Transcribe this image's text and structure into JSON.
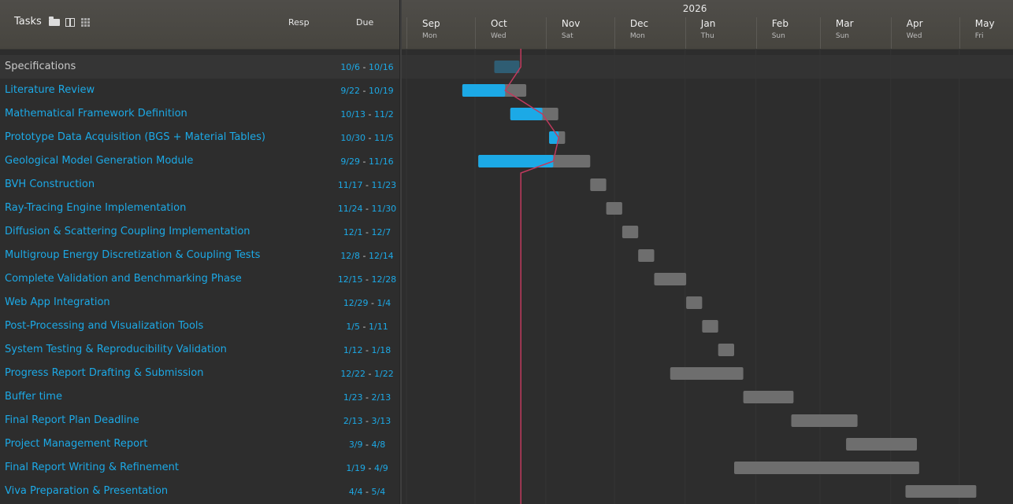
{
  "header": {
    "tasks_label": "Tasks",
    "icons": [
      "folder-open-icon",
      "table-layout-icon",
      "grid-icon"
    ],
    "resp_label": "Resp",
    "due_label": "Due"
  },
  "timeline": {
    "year": "2026",
    "months": [
      {
        "label": "Sep",
        "day": "Mon"
      },
      {
        "label": "Oct",
        "day": "Wed"
      },
      {
        "label": "Nov",
        "day": "Sat"
      },
      {
        "label": "Dec",
        "day": "Mon"
      },
      {
        "label": "Jan",
        "day": "Thu"
      },
      {
        "label": "Feb",
        "day": "Sun"
      },
      {
        "label": "Mar",
        "day": "Sun"
      },
      {
        "label": "Apr",
        "day": "Wed"
      },
      {
        "label": "May",
        "day": "Fri"
      }
    ]
  },
  "colors": {
    "progress": "#1ca9e6",
    "remaining": "#6e6e6e",
    "group_bar": "#2f5d73",
    "today_line": "#c23a5e",
    "link_text": "#1ca9e6"
  },
  "tasks": [
    {
      "name": "Specifications",
      "start": "10/6",
      "end": "10/16",
      "group": true,
      "progress": 0
    },
    {
      "name": "Literature Review",
      "start": "9/22",
      "end": "10/19",
      "progress": 0.67
    },
    {
      "name": "Mathematical Framework Definition",
      "start": "10/13",
      "end": "11/2",
      "progress": 0.67
    },
    {
      "name": "Prototype Data Acquisition (BGS + Material Tables)",
      "start": "10/30",
      "end": "11/5",
      "progress": 0.6
    },
    {
      "name": "Geological Model Generation Module",
      "start": "9/29",
      "end": "11/16",
      "progress": 0.67
    },
    {
      "name": "BVH Construction",
      "start": "11/17",
      "end": "11/23",
      "progress": 0
    },
    {
      "name": "Ray-Tracing Engine Implementation",
      "start": "11/24",
      "end": "11/30",
      "progress": 0
    },
    {
      "name": "Diffusion & Scattering Coupling Implementation",
      "start": "12/1",
      "end": "12/7",
      "progress": 0
    },
    {
      "name": "Multigroup Energy Discretization & Coupling Tests",
      "start": "12/8",
      "end": "12/14",
      "progress": 0
    },
    {
      "name": "Complete Validation and Benchmarking Phase",
      "start": "12/15",
      "end": "12/28",
      "progress": 0
    },
    {
      "name": "Web App Integration",
      "start": "12/29",
      "end": "1/4",
      "progress": 0
    },
    {
      "name": "Post-Processing and Visualization Tools",
      "start": "1/5",
      "end": "1/11",
      "progress": 0
    },
    {
      "name": "System Testing & Reproducibility Validation",
      "start": "1/12",
      "end": "1/18",
      "progress": 0
    },
    {
      "name": "Progress Report Drafting & Submission",
      "start": "12/22",
      "end": "1/22",
      "progress": 0
    },
    {
      "name": "Buffer time",
      "start": "1/23",
      "end": "2/13",
      "progress": 0
    },
    {
      "name": "Final Report Plan Deadline",
      "start": "2/13",
      "end": "3/13",
      "progress": 0
    },
    {
      "name": "Project Management Report",
      "start": "3/9",
      "end": "4/8",
      "progress": 0
    },
    {
      "name": "Final Report Writing & Refinement",
      "start": "1/19",
      "end": "4/9",
      "progress": 0
    },
    {
      "name": "Viva Preparation & Presentation",
      "start": "4/4",
      "end": "5/4",
      "progress": 0
    }
  ]
}
